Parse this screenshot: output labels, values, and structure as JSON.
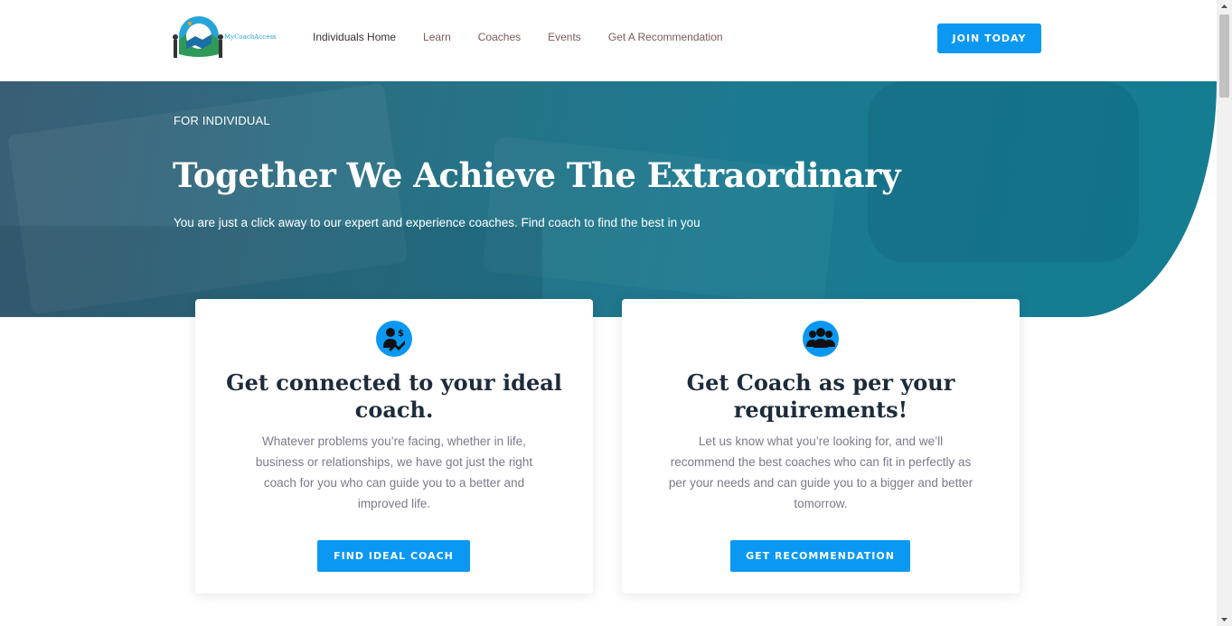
{
  "header": {
    "logo_text": "MyCoachAccess",
    "nav": [
      {
        "label": "Individuals Home",
        "active": true
      },
      {
        "label": "Learn",
        "active": false
      },
      {
        "label": "Coaches",
        "active": false
      },
      {
        "label": "Events",
        "active": false
      },
      {
        "label": "Get A Recommendation",
        "active": false
      }
    ],
    "join_label": "JOIN TODAY"
  },
  "hero": {
    "kicker": "FOR INDIVIDUAL",
    "title": "Together We Achieve The Extraordinary",
    "subtitle": "You are just a click away to our expert and experience coaches. Find coach to find the best in you"
  },
  "cards": [
    {
      "icon": "coach-money-growth-icon",
      "title": "Get connected to your ideal coach.",
      "text": "Whatever problems you’re facing, whether in life, business or relationships, we have got just the right coach for you who can guide you to a better and improved life.",
      "button": "FIND IDEAL COACH"
    },
    {
      "icon": "group-people-icon",
      "title": "Get Coach as per your requirements!",
      "text": "Let us know what you’re looking for, and we’ll recommend the best coaches who can fit in perfectly as per your needs and can guide you to a bigger and better tomorrow.",
      "button": "GET RECOMMENDATION"
    }
  ],
  "colors": {
    "accent": "#0a98f2",
    "hero": "#1c7a90",
    "heading": "#1e2b3a",
    "body_text": "#7a7a8a"
  }
}
